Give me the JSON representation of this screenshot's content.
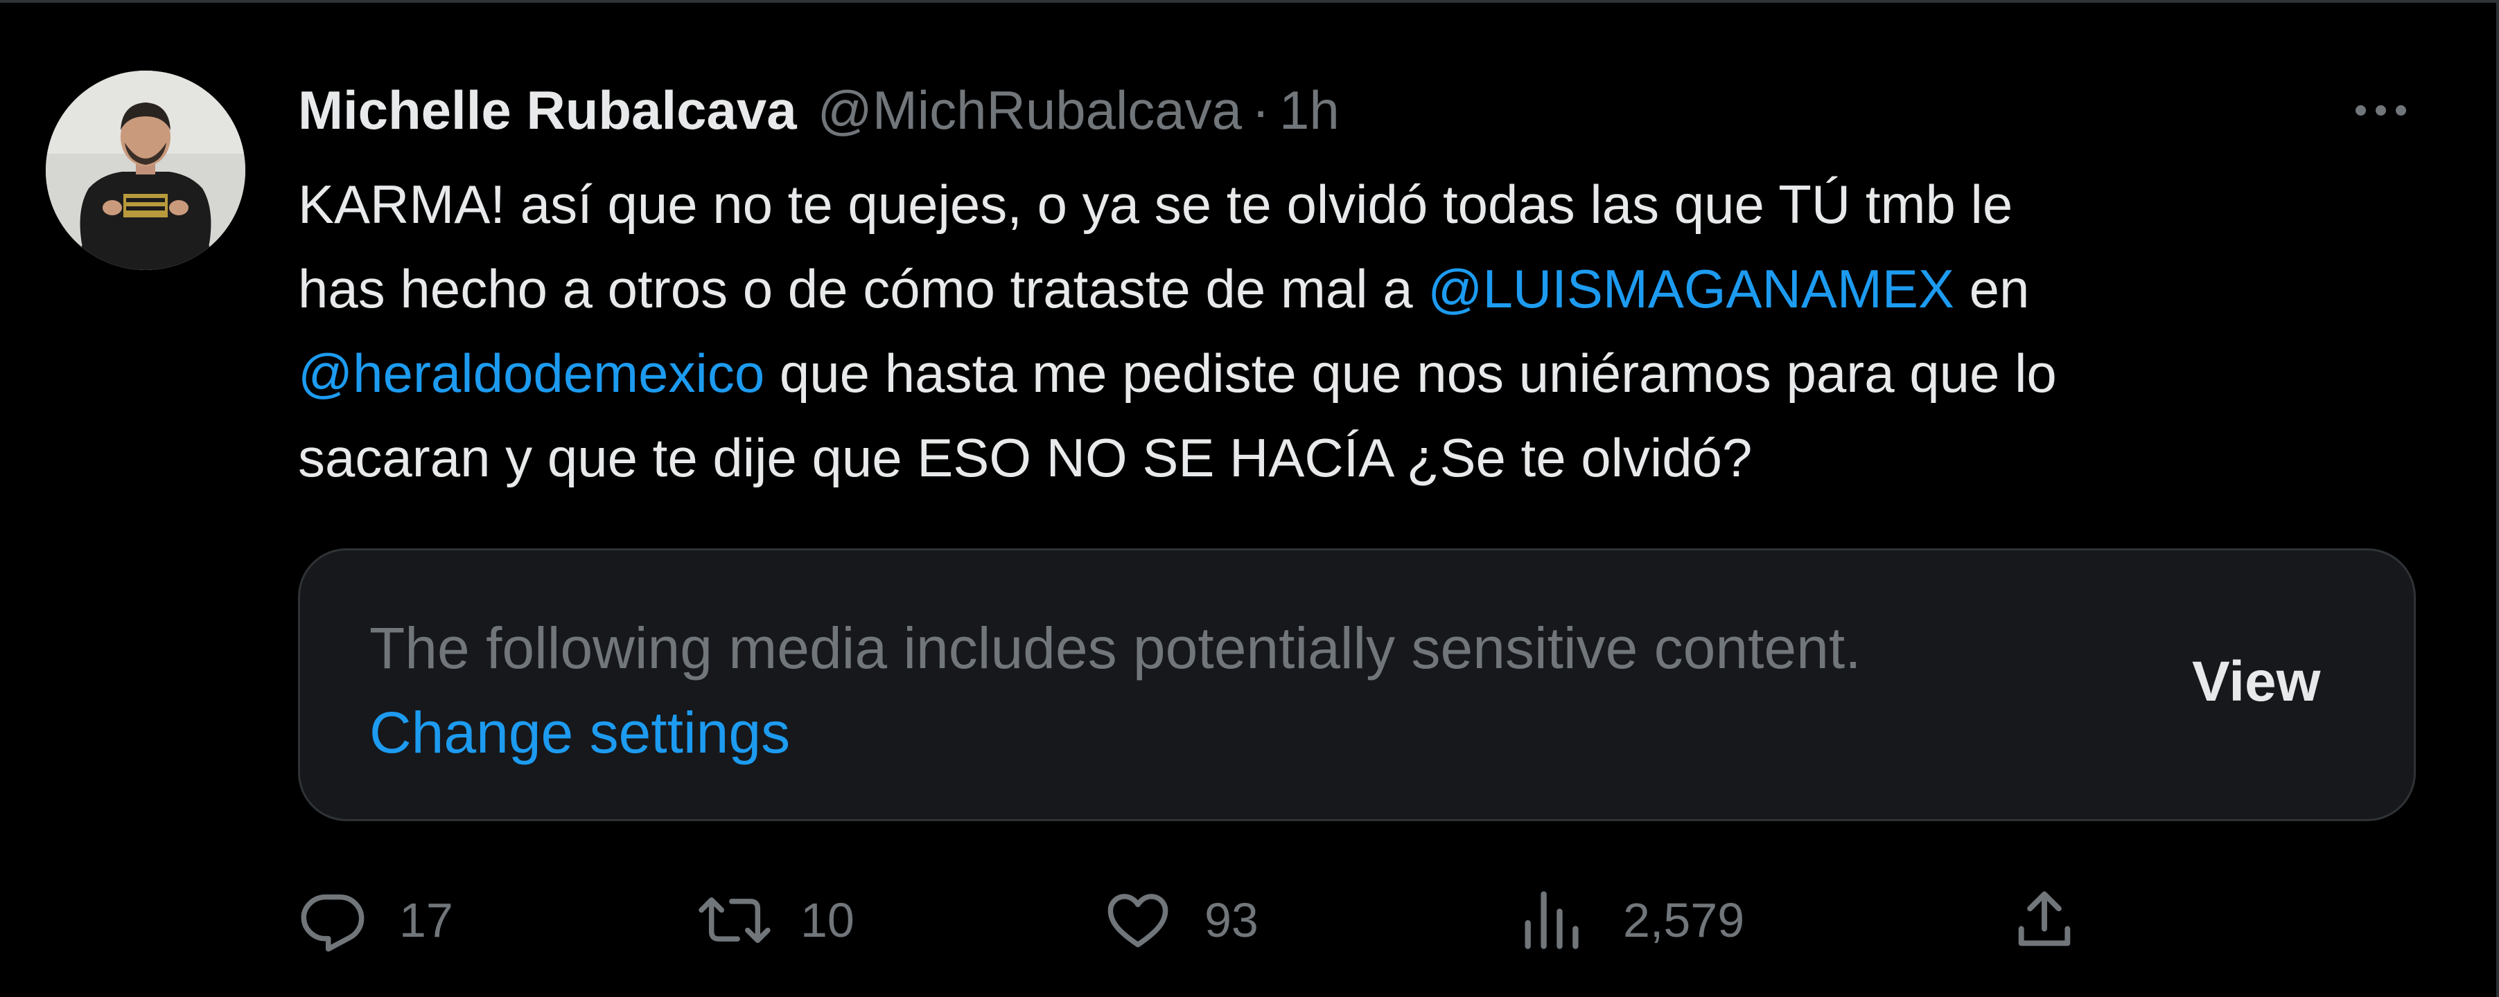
{
  "tweet": {
    "author": {
      "display_name": "Michelle Rubalcava",
      "handle": "@MichRubalcava",
      "separator": "·",
      "time": "1h"
    },
    "text_lines": [
      [
        {
          "text": "KARMA! así que no te quejes, o ya se te olvidó todas las que TÚ tmb le",
          "mention": false
        }
      ],
      [
        {
          "text": "has hecho a otros o de cómo trataste de mal a ",
          "mention": false
        },
        {
          "text": "@LUISMAGANAMEX",
          "mention": true
        },
        {
          "text": "  en",
          "mention": false
        }
      ],
      [
        {
          "text": "@heraldodemexico",
          "mention": true
        },
        {
          "text": " que hasta me pediste que nos uniéramos para que lo",
          "mention": false
        }
      ],
      [
        {
          "text": "sacaran y que te dije que ESO NO SE HACÍA ¿Se te olvidó?",
          "mention": false
        }
      ]
    ],
    "sensitive_media": {
      "message": "The following media includes potentially sensitive content.",
      "link_label": "Change settings",
      "view_label": "View"
    },
    "actions": {
      "replies": {
        "icon": "reply-icon",
        "count": "17"
      },
      "retweets": {
        "icon": "retweet-icon",
        "count": "10"
      },
      "likes": {
        "icon": "heart-icon",
        "count": "93"
      },
      "views": {
        "icon": "analytics-icon",
        "count": "2,579"
      },
      "share": {
        "icon": "share-icon"
      }
    }
  },
  "colors": {
    "background": "#000000",
    "text_primary": "#e7e9ea",
    "text_secondary": "#71767b",
    "link": "#1d9bf0",
    "card_background": "#16181c",
    "border": "#2f3336"
  }
}
